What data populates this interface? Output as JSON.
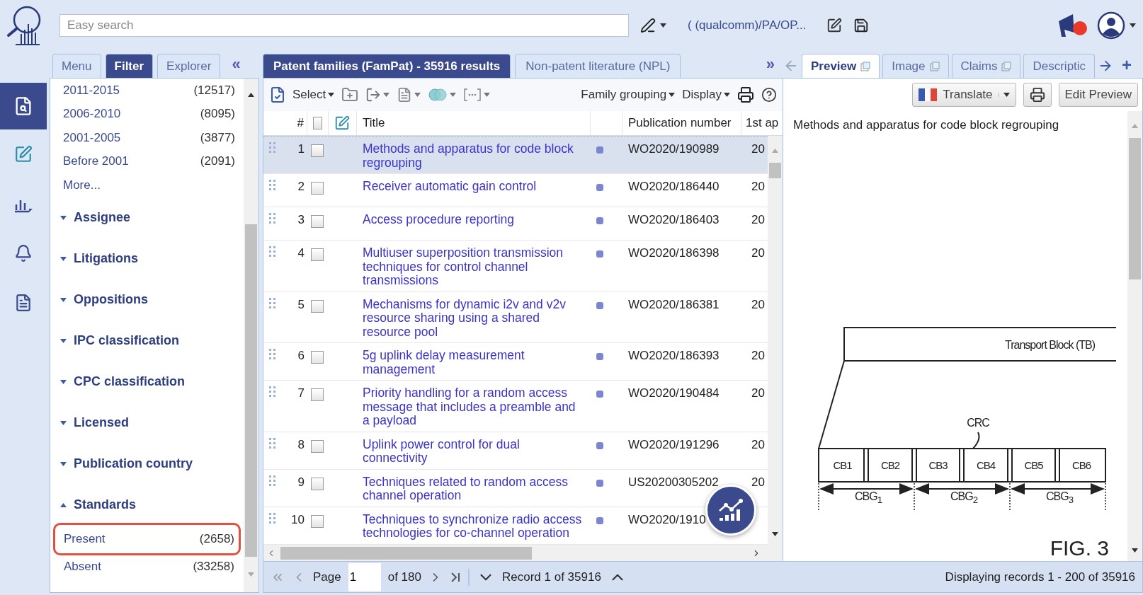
{
  "top_bar": {
    "search": {
      "placeholder": "Easy search"
    },
    "query": "( (qualcomm)/PA/OP..."
  },
  "side_rail": {
    "items": [
      {
        "selected": true
      },
      {
        "selected": false
      },
      {
        "selected": false
      },
      {
        "selected": false
      },
      {
        "selected": false
      }
    ]
  },
  "left_tabs": [
    {
      "label": "Menu",
      "selected": false
    },
    {
      "label": "Filter",
      "selected": true
    },
    {
      "label": "Explorer",
      "selected": false
    }
  ],
  "collapse": "«",
  "filter": {
    "entries": [
      {
        "label": "2011-2015",
        "count": "(12517)"
      },
      {
        "label": "2006-2010",
        "count": "(8095)"
      },
      {
        "label": "2001-2005",
        "count": "(3877)"
      },
      {
        "label": "Before 2001",
        "count": "(2091)"
      }
    ],
    "more": "More...",
    "sections": [
      {
        "title": "Assignee",
        "expanded": false
      },
      {
        "title": "Litigations",
        "expanded": false
      },
      {
        "title": "Oppositions",
        "expanded": false
      },
      {
        "title": "IPC classification",
        "expanded": false
      },
      {
        "title": "CPC classification",
        "expanded": false
      },
      {
        "title": "Licensed",
        "expanded": false
      },
      {
        "title": "Publication country",
        "expanded": false
      },
      {
        "title": "Standards",
        "expanded": true,
        "options": [
          {
            "label": "Present",
            "count": "(2658)",
            "highlighted": true
          },
          {
            "label": "Absent",
            "count": "(33258)",
            "highlighted": false
          }
        ]
      }
    ]
  },
  "result_tabs": [
    {
      "label": "Patent families (FamPat) - 35916 results",
      "selected": true
    },
    {
      "label": "Non-patent literature (NPL)",
      "selected": false
    }
  ],
  "expand": "»",
  "toolbar": {
    "select": "Select",
    "grouping": "Family grouping",
    "display": "Display"
  },
  "table": {
    "columns": [
      "#",
      "Title",
      "Publication number",
      "1st ap"
    ],
    "all_checked": false,
    "rows": [
      {
        "num": "1",
        "title": "Methods and apparatus for code block regrouping",
        "publication": "WO2020/190989",
        "first_app": "20",
        "selected": true,
        "checked": false
      },
      {
        "num": "2",
        "title": "Receiver automatic gain control",
        "publication": "WO2020/186440",
        "first_app": "20",
        "selected": false,
        "checked": false
      },
      {
        "num": "3",
        "title": "Access procedure reporting",
        "publication": "WO2020/186403",
        "first_app": "20",
        "selected": false,
        "checked": false
      },
      {
        "num": "4",
        "title": "Multiuser superposition transmission techniques for control channel transmissions",
        "publication": "WO2020/186398",
        "first_app": "20",
        "selected": false,
        "checked": false
      },
      {
        "num": "5",
        "title": "Mechanisms for dynamic i2v and v2v resource sharing using a shared resource pool",
        "publication": "WO2020/186381",
        "first_app": "20",
        "selected": false,
        "checked": false
      },
      {
        "num": "6",
        "title": "5g uplink delay measurement management",
        "publication": "WO2020/186393",
        "first_app": "20",
        "selected": false,
        "checked": false
      },
      {
        "num": "7",
        "title": "Priority handling for a random access message that includes a preamble and a payload",
        "publication": "WO2020/190484",
        "first_app": "20",
        "selected": false,
        "checked": false
      },
      {
        "num": "8",
        "title": "Uplink power control for dual connectivity",
        "publication": "WO2020/191296",
        "first_app": "20",
        "selected": false,
        "checked": false
      },
      {
        "num": "9",
        "title": "Techniques related to random access channel operation",
        "publication": "US20200305202",
        "first_app": "20",
        "selected": false,
        "checked": false
      },
      {
        "num": "10",
        "title": "Techniques to synchronize radio access technologies for co-channel operation",
        "publication": "WO2020/1910",
        "selected": false,
        "checked": false
      }
    ]
  },
  "pagination": {
    "page_label": "Page",
    "page": "1",
    "of": "of 180",
    "record": "Record 1 of 35916",
    "summary": "Displaying records 1 - 200 of 35916"
  },
  "preview_tabs": [
    {
      "label": "Preview",
      "selected": true
    },
    {
      "label": "Image",
      "selected": false
    },
    {
      "label": "Claims",
      "selected": false
    },
    {
      "label": "Descriptic",
      "selected": false
    }
  ],
  "add_tab": "+",
  "preview": {
    "translate": "Translate",
    "edit": "Edit Preview",
    "title": "Methods and apparatus for code block regrouping",
    "figure": {
      "block": "Transport Block (TB)",
      "crc": "CRC",
      "code_blocks": [
        "CB1",
        "CB2",
        "CB3",
        "CB4",
        "CB5",
        "CB6"
      ],
      "groups": [
        "CBG$_{1}$",
        "CBG$_{2}$",
        "CBG$_{3}$"
      ],
      "caption": "FIG. 3"
    }
  }
}
